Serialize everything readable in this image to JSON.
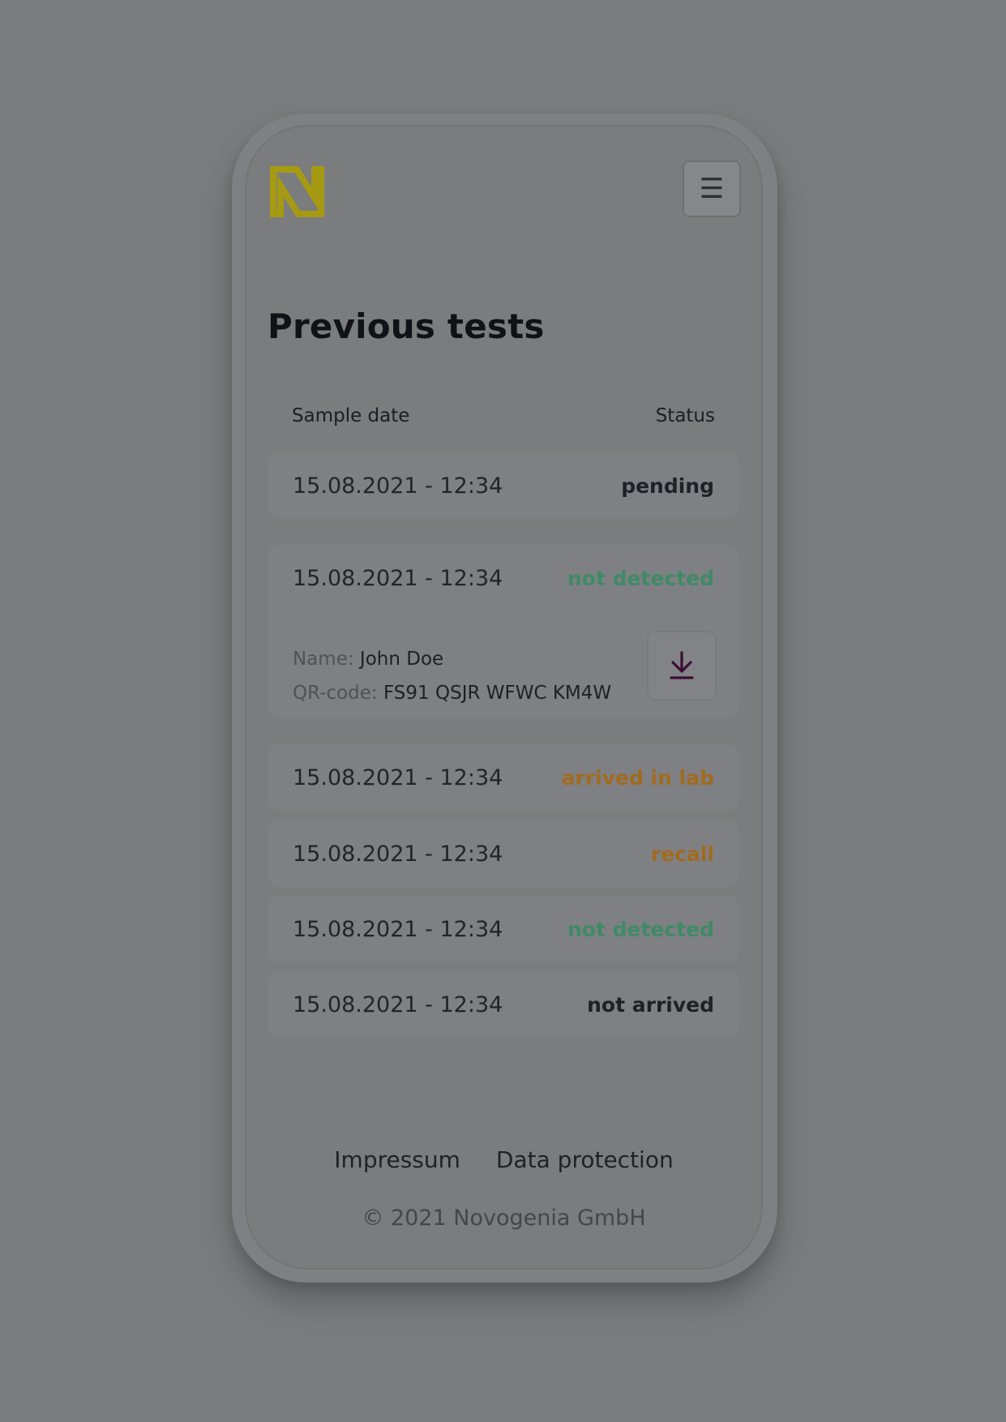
{
  "header": {
    "logo_icon": "novogenia-logo",
    "logo_color": "#a69a12",
    "menu_icon": "hamburger-icon",
    "menu_glyph": "☰"
  },
  "page": {
    "title": "Previous tests"
  },
  "table": {
    "columns": {
      "date": "Sample date",
      "status": "Status"
    },
    "rows": [
      {
        "date": "15.08.2021 - 12:34",
        "status": "pending",
        "status_color": "#1e2127"
      },
      {
        "date": "15.08.2021 - 12:34",
        "status": "not detected",
        "status_color": "#3f8a67"
      },
      {
        "date": "15.08.2021 - 12:34",
        "status": "arrived in lab",
        "status_color": "#a16b1f"
      },
      {
        "date": "15.08.2021 - 12:34",
        "status": "recall",
        "status_color": "#a16b1f"
      },
      {
        "date": "15.08.2021 - 12:34",
        "status": "not detected",
        "status_color": "#3f8a67"
      },
      {
        "date": "15.08.2021 - 12:34",
        "status": "not arrived",
        "status_color": "#1e2127"
      }
    ],
    "expanded": {
      "name_label": "Name:",
      "name_value": "John Doe",
      "qr_label": "QR-code:",
      "qr_value": "FS91 QSJR WFWC KM4W",
      "download_icon": "download-icon",
      "download_color": "#3b0f35"
    }
  },
  "footer": {
    "impressum": "Impressum",
    "data_protection": "Data protection",
    "copyright": "© 2021 Novogenia GmbH"
  }
}
